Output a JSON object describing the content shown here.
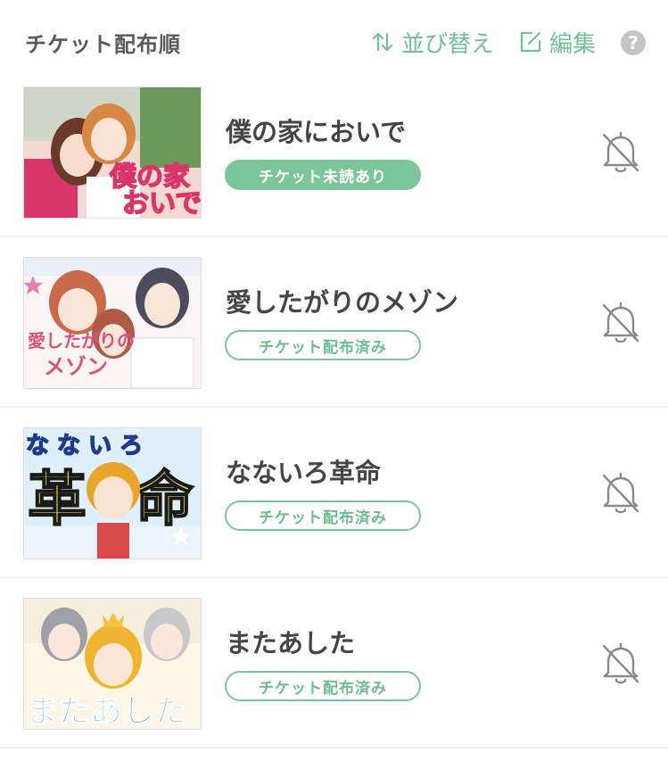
{
  "header": {
    "title": "チケット配布順",
    "sort_label": "並び替え",
    "edit_label": "編集",
    "help_label": "?"
  },
  "colors": {
    "accent": "#7cc49c",
    "title_text": "#454545",
    "header_text": "#5a5a5a",
    "icon_gray": "#8a8a8a"
  },
  "items": [
    {
      "title": "僕の家においで",
      "status": "チケット未読あり",
      "cover_text": "僕の家においで",
      "bell_icon": "bell-off-icon"
    },
    {
      "title": "愛したがりのメゾン",
      "status": "チケット配布済み",
      "cover_text": "愛したがりのメゾン",
      "bell_icon": "bell-off-icon"
    },
    {
      "title": "なないろ革命",
      "status": "チケット配布済み",
      "cover_text": "なないろ革命",
      "bell_icon": "bell-off-icon"
    },
    {
      "title": "またあした",
      "status": "チケット配布済み",
      "cover_text": "またあした",
      "bell_icon": "bell-off-icon"
    }
  ]
}
